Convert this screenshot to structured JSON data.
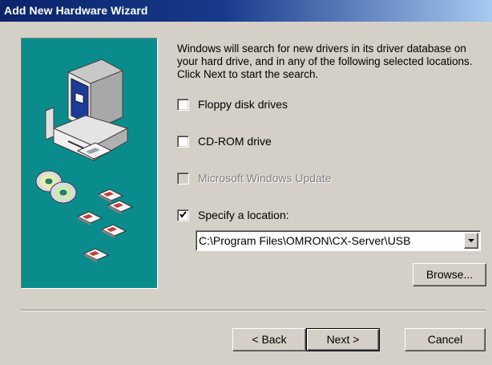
{
  "window": {
    "title": "Add New Hardware Wizard"
  },
  "description": "Windows will search for new drivers in its driver database on your hard drive, and in any of the following selected locations. Click Next to start the search.",
  "options": [
    {
      "label": "Floppy disk drives",
      "checked": false,
      "enabled": true
    },
    {
      "label": "CD-ROM drive",
      "checked": false,
      "enabled": true
    },
    {
      "label": "Microsoft Windows Update",
      "checked": false,
      "enabled": false
    },
    {
      "label": "Specify a location:",
      "checked": true,
      "enabled": true
    }
  ],
  "location": {
    "value": "C:\\Program Files\\OMRON\\CX-Server\\USB"
  },
  "buttons": {
    "browse": "Browse...",
    "back": "< Back",
    "next": "Next >",
    "cancel": "Cancel"
  },
  "colors": {
    "dialog_bg": "#d4d0c8",
    "title_bar": "#0b246a",
    "illustration_bg": "#0a8c8c"
  },
  "illustration": {
    "icons": [
      "computer-icon",
      "cd-disc-icon",
      "floppy-disk-icon"
    ]
  }
}
